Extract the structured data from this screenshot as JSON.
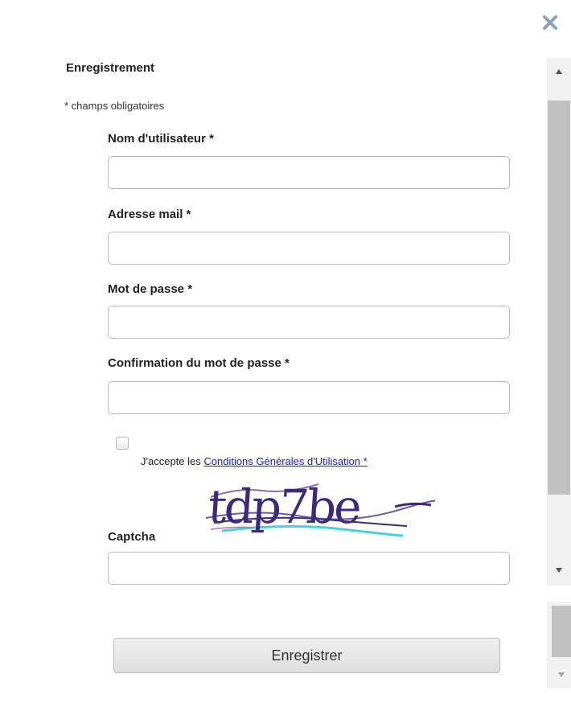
{
  "dialog": {
    "title": "Enregistrement",
    "required_note": "* champs obligatoires",
    "close_icon": "close-icon",
    "fields": {
      "username": {
        "label": "Nom d'utilisateur *",
        "value": "",
        "placeholder": ""
      },
      "email": {
        "label": "Adresse mail *",
        "value": "",
        "placeholder": ""
      },
      "password": {
        "label": "Mot de passe *",
        "value": "",
        "placeholder": ""
      },
      "password_confirm": {
        "label": "Confirmation du mot de passe *",
        "value": "",
        "placeholder": ""
      },
      "captcha": {
        "label": "Captcha",
        "value": "",
        "placeholder": ""
      }
    },
    "terms": {
      "prefix": "J'accepte les ",
      "link_text": "Conditions Générales d'Utilisation *",
      "checked": false
    },
    "captcha_image": {
      "text": "tdp7be"
    },
    "submit_label": "Enregistrer"
  },
  "colors": {
    "close_icon": "#8aa2b4",
    "link": "#1a1aee",
    "captcha_ink": "#3c2a7a"
  }
}
